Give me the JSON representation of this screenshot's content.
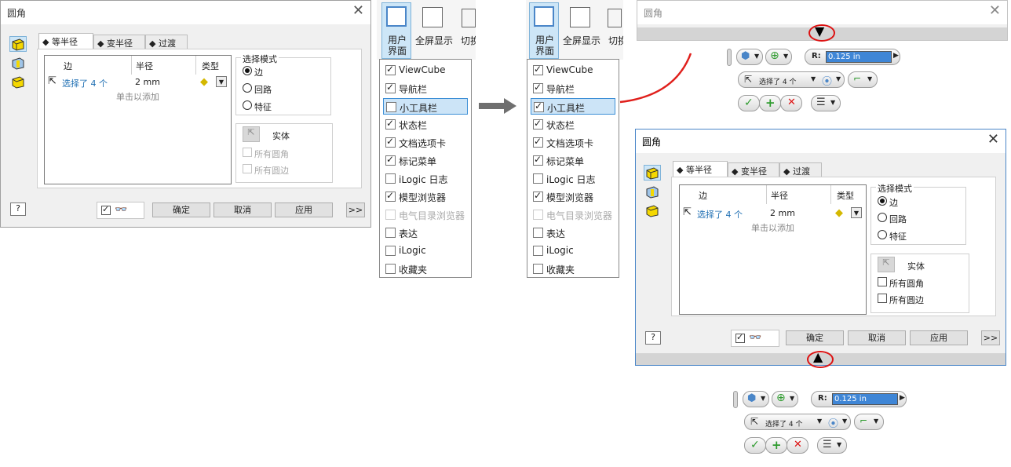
{
  "dialog": {
    "title": "圆角",
    "tabs": [
      "等半径",
      "变半径",
      "过渡"
    ],
    "columns": {
      "edge": "边",
      "radius": "半径",
      "type": "类型"
    },
    "row": {
      "selected": "选择了 4 个",
      "radius": "2 mm"
    },
    "add_hint": "单击以添加",
    "select_mode": {
      "label": "选择模式",
      "options": [
        "边",
        "回路",
        "特征"
      ],
      "selected": "边"
    },
    "solid": {
      "label": "实体",
      "all_fillets": "所有圆角",
      "all_edges": "所有圆边"
    },
    "buttons": {
      "ok": "确定",
      "cancel": "取消",
      "apply": "应用",
      "more": ">>"
    }
  },
  "ribbon": {
    "user_interface": "用户\n界面",
    "user_interface_l1": "用户",
    "user_interface_l2": "界面",
    "fullscreen": "全屏显示",
    "switch": "切换"
  },
  "menu_before": [
    {
      "label": "ViewCube",
      "checked": true
    },
    {
      "label": "导航栏",
      "checked": true
    },
    {
      "label": "小工具栏",
      "checked": false,
      "highlight": true
    },
    {
      "label": "状态栏",
      "checked": true
    },
    {
      "label": "文档选项卡",
      "checked": true
    },
    {
      "label": "标记菜单",
      "checked": true
    },
    {
      "label": "iLogic 日志",
      "checked": false
    },
    {
      "label": "模型浏览器",
      "checked": true
    },
    {
      "label": "电气目录浏览器",
      "checked": false,
      "disabled": true
    },
    {
      "label": "表达",
      "checked": false
    },
    {
      "label": "iLogic",
      "checked": false
    },
    {
      "label": "收藏夹",
      "checked": false
    }
  ],
  "menu_after": [
    {
      "label": "ViewCube",
      "checked": true
    },
    {
      "label": "导航栏",
      "checked": true
    },
    {
      "label": "小工具栏",
      "checked": true,
      "highlight": true
    },
    {
      "label": "状态栏",
      "checked": true
    },
    {
      "label": "文档选项卡",
      "checked": true
    },
    {
      "label": "标记菜单",
      "checked": true
    },
    {
      "label": "iLogic 日志",
      "checked": false
    },
    {
      "label": "模型浏览器",
      "checked": true
    },
    {
      "label": "电气目录浏览器",
      "checked": false,
      "disabled": true
    },
    {
      "label": "表达",
      "checked": false
    },
    {
      "label": "iLogic",
      "checked": false
    },
    {
      "label": "收藏夹",
      "checked": false
    }
  ],
  "minibar": {
    "radius_label": "R:",
    "radius_value": "0.125 in",
    "selected": "选择了 4 个"
  },
  "colors": {
    "accent": "#3f86d6",
    "highlight": "#cce4f7",
    "callout": "#e0201c",
    "ok_green": "#2e9b2e",
    "cancel_red": "#d11"
  }
}
